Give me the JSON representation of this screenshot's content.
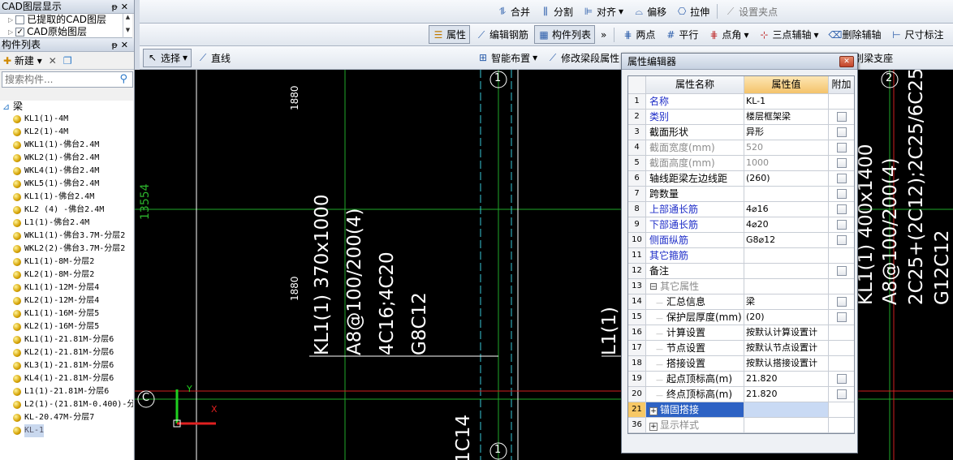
{
  "left": {
    "layer_panel_title": "CAD图层显示",
    "layers": [
      {
        "label": "已提取的CAD图层",
        "checked": false
      },
      {
        "label": "CAD原始图层",
        "checked": true
      }
    ],
    "component_panel_title": "构件列表",
    "new_label": "新建",
    "search_placeholder": "搜索构件...",
    "tree_root": "梁",
    "tree_items": [
      "KL1(1)-4M",
      "KL2(1)-4M",
      "WKL1(1)-佛台2.4M",
      "WKL2(1)-佛台2.4M",
      "WKL4(1)-佛台2.4M",
      "WKL5(1)-佛台2.4M",
      "KL1(1)-佛台2.4M",
      "KL2 (4) -佛台2.4M",
      "L1(1)-佛台2.4M",
      "WKL1(1)-佛台3.7M-分层2",
      "WKL2(2)-佛台3.7M-分层2",
      "KL1(1)-8M-分层2",
      "KL2(1)-8M-分层2",
      "KL1(1)-12M-分层4",
      "KL2(1)-12M-分层4",
      "KL1(1)-16M-分层5",
      "KL2(1)-16M-分层5",
      "KL1(1)-21.81M-分层6",
      "KL2(1)-21.81M-分层6",
      "KL3(1)-21.81M-分层6",
      "KL4(1)-21.81M-分层6",
      "L1(1)-21.81M-分层6",
      "L2(1)-(21.81M-0.400)-分层6",
      "KL-20.47M-分层7",
      "KL-1"
    ]
  },
  "toolbar1": {
    "merge": "合并",
    "split": "分割",
    "align": "对齐",
    "offset": "偏移",
    "stretch": "拉伸",
    "grip": "设置夹点"
  },
  "toolbar2": {
    "props": "属性",
    "edit_rebar": "编辑钢筋",
    "comp_list": "构件列表",
    "more": "»",
    "two_points": "两点",
    "parallel": "平行",
    "point_angle": "点角",
    "three_point_aux": "三点辅轴",
    "delete_aux": "删除辅轴",
    "dim": "尺寸标注"
  },
  "toolbar3": {
    "select": "选择",
    "line": "直线",
    "smart_layout": "智能布置",
    "modify_span": "修改梁段属性",
    "identify_support": "识别梁支座"
  },
  "canvas": {
    "dim1": "1880",
    "dim2": "1880",
    "dim_left": "13554",
    "axis_1": "1",
    "axis_2": "2",
    "axis_c": "C",
    "axis_1b": "1",
    "ann1": "KL1(1) 370x1000",
    "ann2": "A8@100/200(4)",
    "ann3": "4C16;4C20",
    "ann4": "G8C12",
    "ann_l1": "L1(1)",
    "ann_1c14": "1C14",
    "right1": "KL1(1) 400x1400",
    "right2": "A8@100/200(4)",
    "right3": "2C25+(2C12);2C25/6C25",
    "right4": "G12C12",
    "axis_x": "X",
    "axis_y": "Y"
  },
  "dialog": {
    "title": "属性编辑器",
    "head_name": "属性名称",
    "head_value": "属性值",
    "head_add": "附加",
    "rows": [
      {
        "num": "1",
        "name": "名称",
        "value": "KL-1",
        "style": "blue",
        "check": false
      },
      {
        "num": "2",
        "name": "类别",
        "value": "楼层框架梁",
        "style": "blue",
        "check": true
      },
      {
        "num": "3",
        "name": "截面形状",
        "value": "异形",
        "style": "",
        "check": true
      },
      {
        "num": "4",
        "name": "截面宽度(mm)",
        "value": "520",
        "style": "grey",
        "check": true
      },
      {
        "num": "5",
        "name": "截面高度(mm)",
        "value": "1000",
        "style": "grey",
        "check": true
      },
      {
        "num": "6",
        "name": "轴线距梁左边线距",
        "value": "(260)",
        "style": "",
        "check": true
      },
      {
        "num": "7",
        "name": "跨数量",
        "value": "",
        "style": "",
        "check": true
      },
      {
        "num": "8",
        "name": "上部通长筋",
        "value": "4⌀16",
        "style": "blue",
        "check": true
      },
      {
        "num": "9",
        "name": "下部通长筋",
        "value": "4⌀20",
        "style": "blue",
        "check": true
      },
      {
        "num": "10",
        "name": "侧面纵筋",
        "value": "G8⌀12",
        "style": "blue",
        "check": true
      },
      {
        "num": "11",
        "name": "其它箍筋",
        "value": "",
        "style": "blue",
        "check": false
      },
      {
        "num": "12",
        "name": "备注",
        "value": "",
        "style": "",
        "check": true
      },
      {
        "num": "13",
        "name": "其它属性",
        "value": "",
        "style": "group",
        "check": false
      },
      {
        "num": "14",
        "name": "汇总信息",
        "value": "梁",
        "style": "child",
        "check": true
      },
      {
        "num": "15",
        "name": "保护层厚度(mm)",
        "value": "(20)",
        "style": "child",
        "check": true
      },
      {
        "num": "16",
        "name": "计算设置",
        "value": "按默认计算设置计",
        "style": "child",
        "check": false
      },
      {
        "num": "17",
        "name": "节点设置",
        "value": "按默认节点设置计",
        "style": "child",
        "check": false
      },
      {
        "num": "18",
        "name": "搭接设置",
        "value": "按默认搭接设置计",
        "style": "child",
        "check": false
      },
      {
        "num": "19",
        "name": "起点顶标高(m)",
        "value": "21.820",
        "style": "child",
        "check": true
      },
      {
        "num": "20",
        "name": "终点顶标高(m)",
        "value": "21.820",
        "style": "child",
        "check": true
      },
      {
        "num": "21",
        "name": "锚固搭接",
        "value": "",
        "style": "active",
        "check": false
      },
      {
        "num": "36",
        "name": "显示样式",
        "value": "",
        "style": "expand",
        "check": false
      }
    ]
  }
}
